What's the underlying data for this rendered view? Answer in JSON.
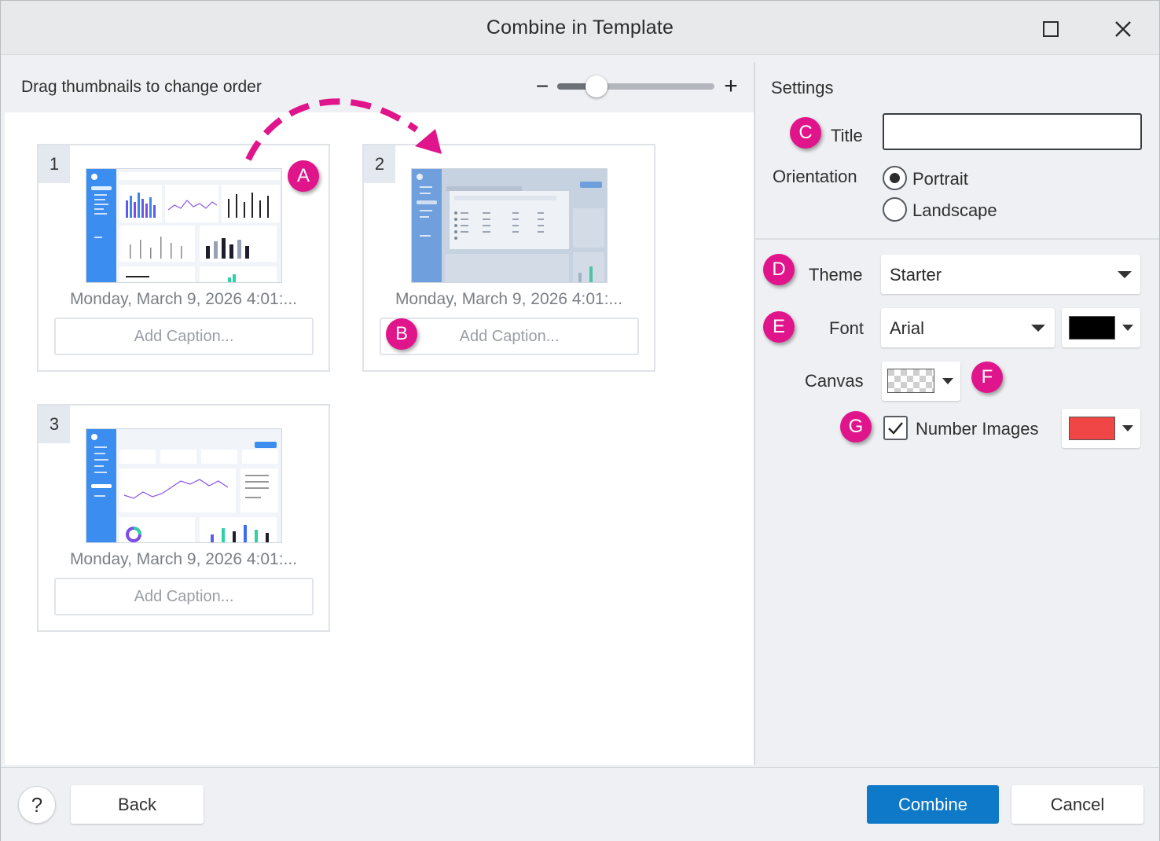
{
  "window": {
    "title": "Combine in Template"
  },
  "left": {
    "drag_hint": "Drag thumbnails to change order",
    "zoom": {
      "minus_label": "−",
      "plus_label": "+",
      "level": 0.25
    }
  },
  "thumbnails": [
    {
      "number": "1",
      "date": "Monday, March 9, 2026 4:01:...",
      "caption_placeholder": "Add Caption..."
    },
    {
      "number": "2",
      "date": "Monday, March 9, 2026 4:01:...",
      "caption_placeholder": "Add Caption..."
    },
    {
      "number": "3",
      "date": "Monday, March 9, 2026 4:01:...",
      "caption_placeholder": "Add Caption..."
    }
  ],
  "settings": {
    "heading": "Settings",
    "title_label": "Title",
    "title_value": "",
    "orientation_label": "Orientation",
    "orientation_options": [
      "Portrait",
      "Landscape"
    ],
    "orientation_selected": "Portrait",
    "theme_label": "Theme",
    "theme_value": "Starter",
    "font_label": "Font",
    "font_value": "Arial",
    "font_color": "#000000",
    "canvas_label": "Canvas",
    "canvas_value": "transparent",
    "number_images_label": "Number Images",
    "number_images_checked": true,
    "number_color": "#f04646"
  },
  "markers": [
    "A",
    "B",
    "C",
    "D",
    "E",
    "F",
    "G"
  ],
  "footer": {
    "help_label": "?",
    "back_label": "Back",
    "combine_label": "Combine",
    "cancel_label": "Cancel"
  },
  "colors": {
    "accent": "#0e78c9",
    "marker": "#e0148b"
  }
}
